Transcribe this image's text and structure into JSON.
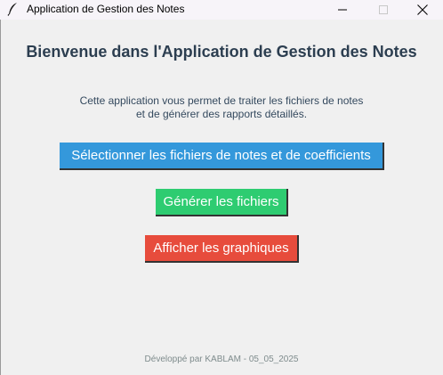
{
  "window": {
    "title": "Application de Gestion des Notes",
    "app_icon": "feather-icon",
    "controls": [
      "minimize-icon",
      "maximize-icon",
      "close-icon"
    ]
  },
  "main": {
    "heading": "Bienvenue dans l'Application de Gestion des Notes",
    "description_line1": "Cette application vous permet de traiter les fichiers de notes",
    "description_line2": "et de générer des rapports détaillés.",
    "buttons": {
      "select_label": "Sélectionner les fichiers de notes et de coefficients",
      "generate_label": "Générer les fichiers",
      "graphs_label": "Afficher les graphiques"
    },
    "footer": "Développé par KABLAM - 05_05_2025"
  },
  "colors": {
    "select": "#3498db",
    "generate": "#2ecc71",
    "graphs": "#e74c3c",
    "heading": "#2c3e50",
    "footer": "#7f8c8d",
    "background": "#f0f0f0"
  }
}
